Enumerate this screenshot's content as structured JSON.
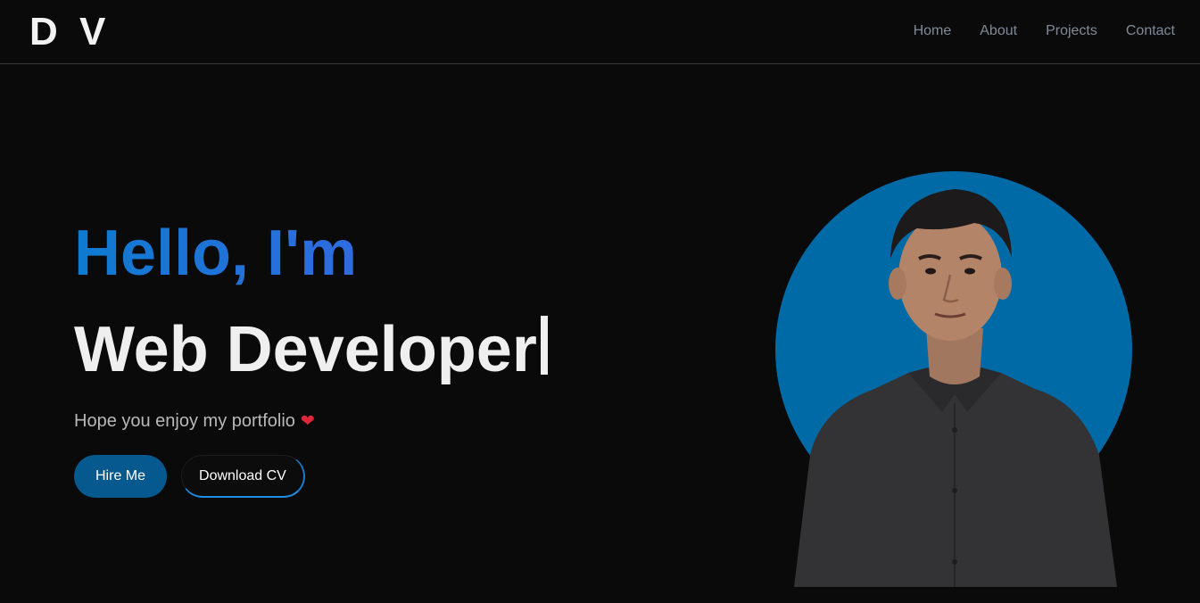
{
  "header": {
    "logo": "D V",
    "nav": [
      "Home",
      "About",
      "Projects",
      "Contact"
    ]
  },
  "hero": {
    "greeting": "Hello, I'm",
    "role": "Web Developer",
    "tagline": "Hope you enjoy my portfolio",
    "tagline_icon": "heart-icon",
    "buttons": {
      "hire": "Hire Me",
      "cv": "Download CV"
    }
  },
  "colors": {
    "background": "#0a0a0a",
    "accent": "#0e7bd0",
    "portrait_circle": "#006aa6",
    "hire_button": "#06598f",
    "nav_text": "#7f8b99"
  }
}
